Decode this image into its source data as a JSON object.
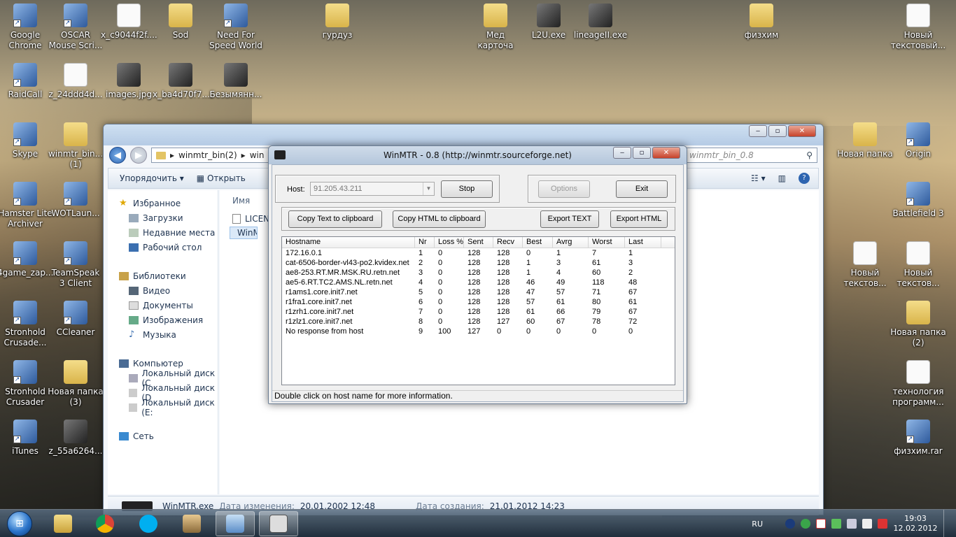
{
  "desktop": {
    "icons": [
      {
        "label": "Google Chrome",
        "kind": "app"
      },
      {
        "label": "OSCAR Mouse Scri...",
        "kind": "app"
      },
      {
        "label": "x_c9044f2f....",
        "kind": "doc"
      },
      {
        "label": "Sod",
        "kind": "folder"
      },
      {
        "label": "Need For Speed World",
        "kind": "app"
      },
      {
        "label": "гурдуз",
        "kind": "folder"
      },
      {
        "label": "Мед карточа",
        "kind": "folder"
      },
      {
        "label": "L2U.exe",
        "kind": "img"
      },
      {
        "label": "lineageII.exe",
        "kind": "img"
      },
      {
        "label": "физхим",
        "kind": "folder"
      },
      {
        "label": "Новый текстовый...",
        "kind": "doc"
      },
      {
        "label": "RaidCall",
        "kind": "app"
      },
      {
        "label": "z_24ddd4d...",
        "kind": "doc"
      },
      {
        "label": "images.jpg",
        "kind": "img"
      },
      {
        "label": "x_ba4d70f7....",
        "kind": "img"
      },
      {
        "label": "Безымянн...",
        "kind": "img"
      },
      {
        "label": "Skype",
        "kind": "app"
      },
      {
        "label": "winmtr_bin... (1)",
        "kind": "folder"
      },
      {
        "label": "Hamster Lite Archiver",
        "kind": "app"
      },
      {
        "label": "WOTLaun...",
        "kind": "app"
      },
      {
        "label": "4game_zap...",
        "kind": "app"
      },
      {
        "label": "TeamSpeak 3 Client",
        "kind": "app"
      },
      {
        "label": "Stronhold Crusade...",
        "kind": "app"
      },
      {
        "label": "CCleaner",
        "kind": "app"
      },
      {
        "label": "Stronhold Crusader",
        "kind": "app"
      },
      {
        "label": "Новая папка (3)",
        "kind": "folder"
      },
      {
        "label": "iTunes",
        "kind": "app"
      },
      {
        "label": "z_55a6264...",
        "kind": "img"
      },
      {
        "label": "Новая папка",
        "kind": "folder"
      },
      {
        "label": "Origin",
        "kind": "app"
      },
      {
        "label": "Battlefield 3",
        "kind": "app"
      },
      {
        "label": "Новый текстов...",
        "kind": "doc"
      },
      {
        "label": "Новый текстов...",
        "kind": "doc"
      },
      {
        "label": "Новая папка (2)",
        "kind": "folder"
      },
      {
        "label": "технология программ...",
        "kind": "doc"
      },
      {
        "label": "физхим.rar",
        "kind": "app"
      }
    ]
  },
  "explorer": {
    "address": {
      "segments": [
        "winmtr_bin(2)",
        "win"
      ]
    },
    "search_placeholder": "winmtr_bin_0.8",
    "toolbar": {
      "organize": "Упорядочить",
      "open": "Открыть"
    },
    "nav": {
      "favorites": "Избранное",
      "fav_items": [
        "Загрузки",
        "Недавние места",
        "Рабочий стол"
      ],
      "libraries": "Библиотеки",
      "lib_items": [
        "Видео",
        "Документы",
        "Изображения",
        "Музыка"
      ],
      "computer": "Компьютер",
      "comp_items": [
        "Локальный диск (C",
        "Локальный диск (D",
        "Локальный диск (E:"
      ],
      "network": "Сеть"
    },
    "column_name": "Имя",
    "files": [
      "LICEN",
      "WinM"
    ],
    "status": {
      "filename": "WinMTR.exe",
      "modified_label": "Дата изменения:",
      "modified": "20.01.2002 12:48",
      "created_label": "Дата создания:",
      "created": "21.01.2012 14:23"
    }
  },
  "winmtr": {
    "title": "WinMTR - 0.8 (http://winmtr.sourceforge.net)",
    "host_label": "Host:",
    "host_value": "91.205.43.211",
    "stop": "Stop",
    "options": "Options",
    "exit": "Exit",
    "copy_text": "Copy Text to clipboard",
    "copy_html": "Copy HTML to clipboard",
    "export_text": "Export TEXT",
    "export_html": "Export HTML",
    "columns": [
      "Hostname",
      "Nr",
      "Loss %",
      "Sent",
      "Recv",
      "Best",
      "Avrg",
      "Worst",
      "Last"
    ],
    "rows": [
      [
        "172.16.0.1",
        "1",
        "0",
        "128",
        "128",
        "0",
        "1",
        "7",
        "1"
      ],
      [
        "cat-6506-border-vl43-po2.kvidex.net",
        "2",
        "0",
        "128",
        "128",
        "1",
        "3",
        "61",
        "3"
      ],
      [
        "ae8-253.RT.MR.MSK.RU.retn.net",
        "3",
        "0",
        "128",
        "128",
        "1",
        "4",
        "60",
        "2"
      ],
      [
        "ae5-6.RT.TC2.AMS.NL.retn.net",
        "4",
        "0",
        "128",
        "128",
        "46",
        "49",
        "118",
        "48"
      ],
      [
        "r1ams1.core.init7.net",
        "5",
        "0",
        "128",
        "128",
        "47",
        "57",
        "71",
        "67"
      ],
      [
        "r1fra1.core.init7.net",
        "6",
        "0",
        "128",
        "128",
        "57",
        "61",
        "80",
        "61"
      ],
      [
        "r1zrh1.core.init7.net",
        "7",
        "0",
        "128",
        "128",
        "61",
        "66",
        "79",
        "67"
      ],
      [
        "r1zlz1.core.init7.net",
        "8",
        "0",
        "128",
        "127",
        "60",
        "67",
        "78",
        "72"
      ],
      [
        "No response from host",
        "9",
        "100",
        "127",
        "0",
        "0",
        "0",
        "0",
        "0"
      ]
    ],
    "status": "Double click on host name for more information."
  },
  "taskbar": {
    "lang": "RU",
    "time": "19:03",
    "date": "12.02.2012"
  }
}
